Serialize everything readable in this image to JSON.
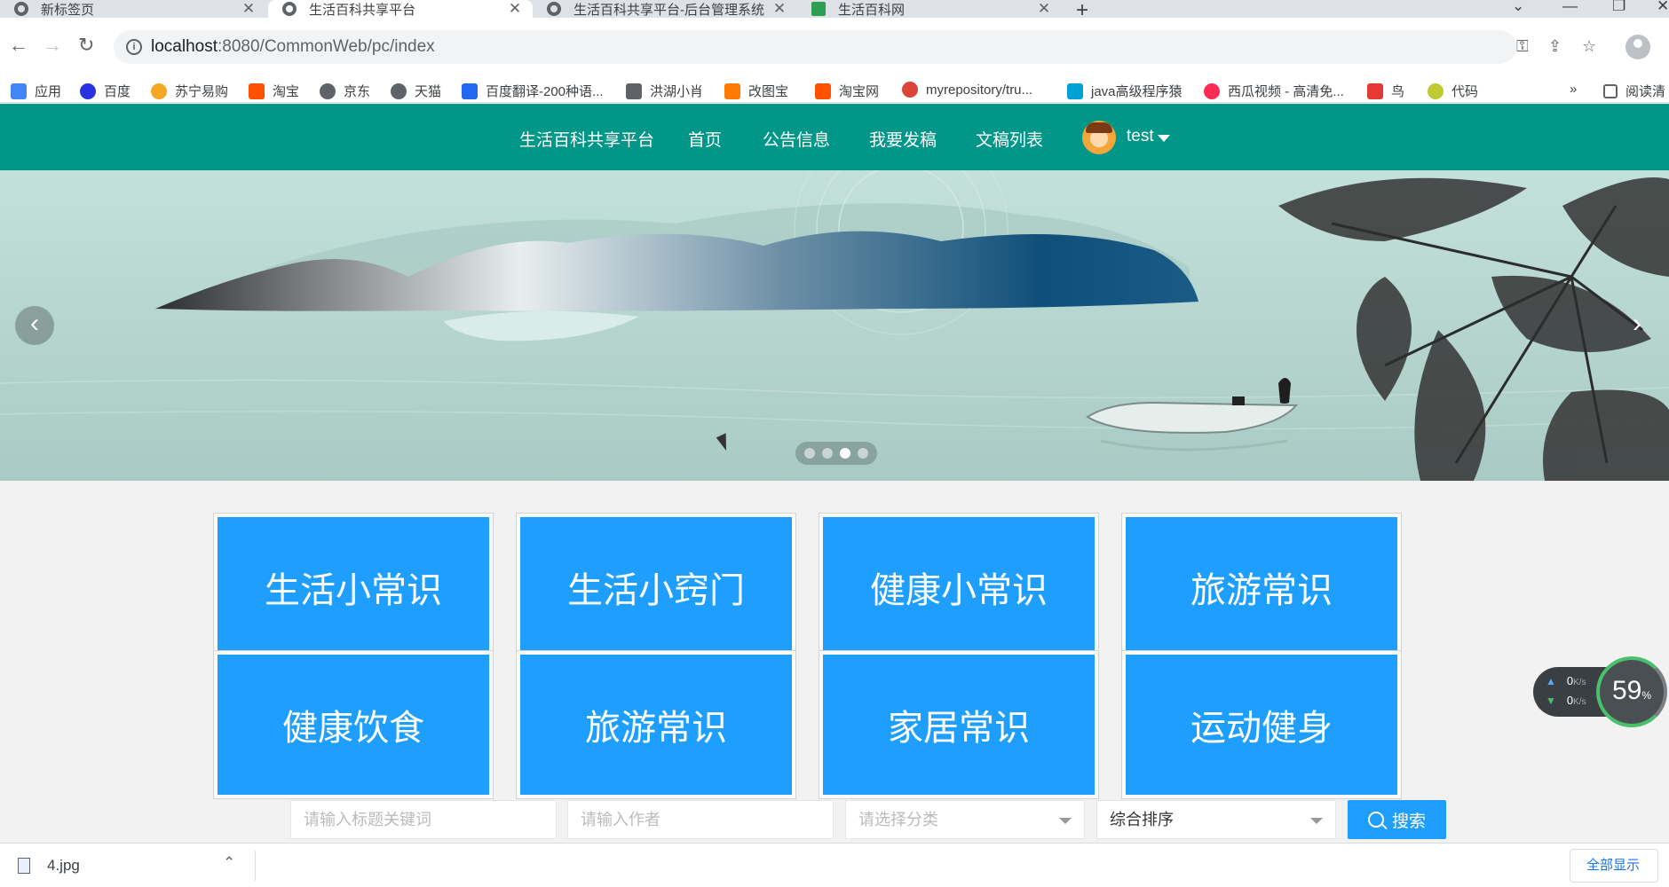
{
  "browser": {
    "tabs": [
      {
        "title": "新标签页",
        "active": false
      },
      {
        "title": "生活百科共享平台",
        "active": true
      },
      {
        "title": "生活百科共享平台-后台管理系统",
        "active": false
      },
      {
        "title": "生活百科网",
        "active": false
      }
    ],
    "new_tab": "+",
    "url_host": "localhost",
    "url_rest": ":8080/CommonWeb/pc/index",
    "bookmarks": [
      {
        "label": "应用",
        "icon": "apps-grid-icon",
        "color": "#4285f4"
      },
      {
        "label": "百度",
        "icon": "baidu-paw-icon",
        "color": "#2932e1"
      },
      {
        "label": "苏宁易购",
        "icon": "suning-icon",
        "color": "#f5a623"
      },
      {
        "label": "淘宝",
        "icon": "taobao-icon",
        "color": "#ff5000"
      },
      {
        "label": "京东",
        "icon": "globe-icon",
        "color": "#5f6368"
      },
      {
        "label": "天猫",
        "icon": "globe-icon",
        "color": "#5f6368"
      },
      {
        "label": "百度翻译-200种语...",
        "icon": "translate-icon",
        "color": "#2468f2"
      },
      {
        "label": "洪湖小肖",
        "icon": "bird-icon",
        "color": "#5f6368"
      },
      {
        "label": "改图宝",
        "icon": "gaitubao-icon",
        "color": "#ff7a00"
      },
      {
        "label": "淘宝网",
        "icon": "taobao-icon",
        "color": "#ff5000"
      },
      {
        "label": "myrepository/tru...",
        "icon": "chrome-icon",
        "color": "#db4437"
      },
      {
        "label": "java高级程序猿",
        "icon": "bilibili-icon",
        "color": "#00a1d6"
      },
      {
        "label": "西瓜视频 - 高清免...",
        "icon": "xigua-icon",
        "color": "#fe2c55"
      },
      {
        "label": "鸟",
        "icon": "bird-red-icon",
        "color": "#e53935"
      },
      {
        "label": "代码",
        "icon": "code-icon",
        "color": "#c0ca33"
      }
    ],
    "more_bookmarks": "»",
    "reading_list": "阅读清"
  },
  "nav": {
    "brand": "生活百科共享平台",
    "items": [
      "首页",
      "公告信息",
      "我要发稿",
      "文稿列表"
    ],
    "username": "test"
  },
  "carousel": {
    "prev": "‹",
    "next": "›",
    "slide_count": 4,
    "active_index": 2
  },
  "categories": [
    "生活小常识",
    "生活小窍门",
    "健康小常识",
    "旅游常识",
    "健康饮食",
    "旅游常识",
    "家居常识",
    "运动健身"
  ],
  "search": {
    "title_placeholder": "请输入标题关键词",
    "author_placeholder": "请输入作者",
    "category_placeholder": "请选择分类",
    "sort_selected": "综合排序",
    "button_label": "搜索"
  },
  "speed_widget": {
    "upload": "0",
    "download": "0",
    "unit": "K/s",
    "percent": "59",
    "percent_unit": "%"
  },
  "download_shelf": {
    "file_name": "4.jpg",
    "show_all": "全部显示"
  },
  "colors": {
    "nav_bg": "#009688",
    "tile_bg": "#1e9fff",
    "accent": "#1e9fff"
  }
}
